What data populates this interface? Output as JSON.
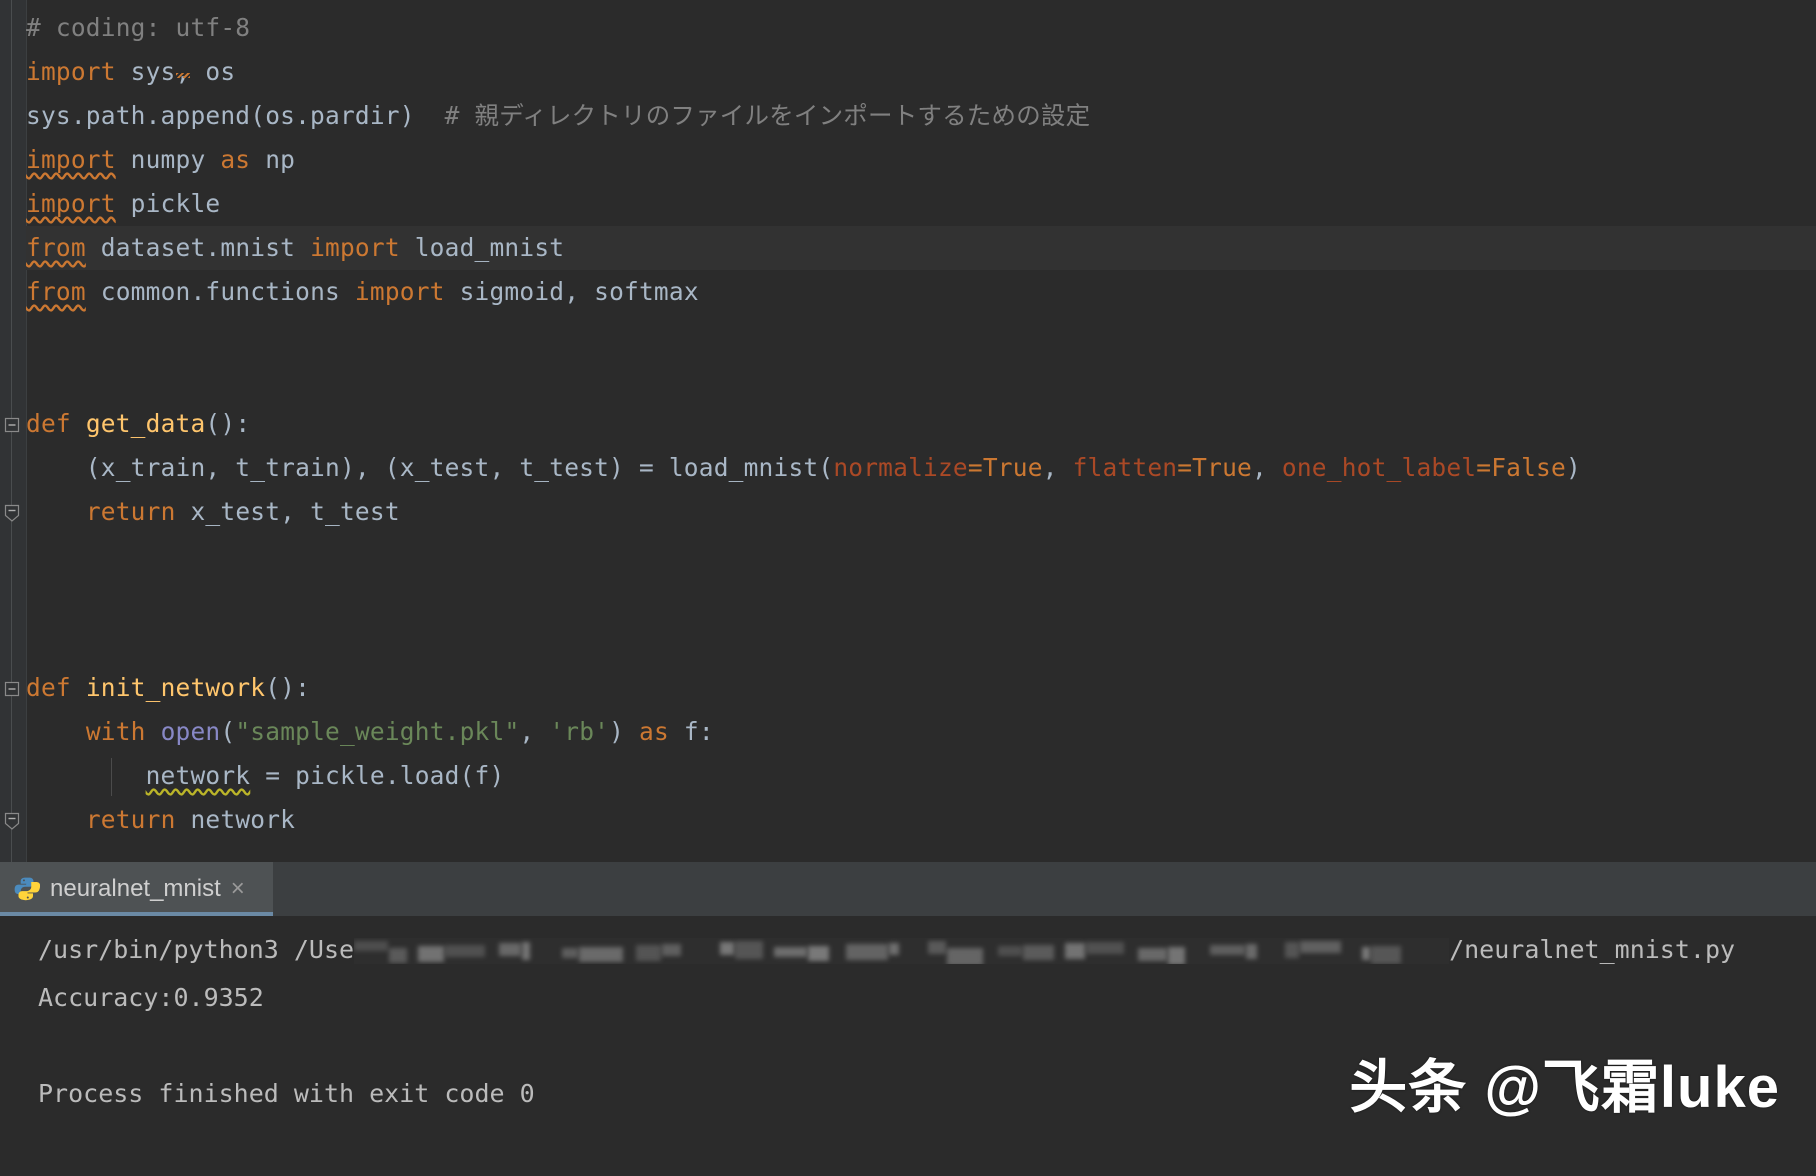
{
  "editor": {
    "lines": [
      {
        "id": "l1",
        "tokens": [
          {
            "t": "# coding: utf-8",
            "c": "cmt"
          }
        ]
      },
      {
        "id": "l2",
        "tokens": [
          {
            "t": "import",
            "c": "kw"
          },
          {
            "t": " sys",
            "c": "plain"
          },
          {
            "t": ",",
            "c": "typo"
          },
          {
            "t": " os",
            "c": "plain"
          }
        ]
      },
      {
        "id": "l3",
        "tokens": [
          {
            "t": "sys.path.append(os.pardir)",
            "c": "plain"
          },
          {
            "t": "  # 親ディレクトリのファイルをインポートするための設定",
            "c": "cmt"
          }
        ]
      },
      {
        "id": "l4",
        "tokens": [
          {
            "t": "import",
            "c": "kw-sq"
          },
          {
            "t": " numpy ",
            "c": "plain"
          },
          {
            "t": "as",
            "c": "kw"
          },
          {
            "t": " np",
            "c": "plain"
          }
        ]
      },
      {
        "id": "l5",
        "tokens": [
          {
            "t": "import",
            "c": "kw-sq"
          },
          {
            "t": " pickle",
            "c": "plain"
          }
        ]
      },
      {
        "id": "l6",
        "hl": true,
        "tokens": [
          {
            "t": "from",
            "c": "kw-sq"
          },
          {
            "t": " dataset.mnist ",
            "c": "plain"
          },
          {
            "t": "import",
            "c": "kw"
          },
          {
            "t": " load_mnist",
            "c": "plain"
          }
        ]
      },
      {
        "id": "l7",
        "tokens": [
          {
            "t": "from",
            "c": "kw-sq"
          },
          {
            "t": " common.functions ",
            "c": "plain"
          },
          {
            "t": "import",
            "c": "kw"
          },
          {
            "t": " sigmoid, softmax",
            "c": "plain"
          }
        ]
      },
      {
        "id": "l8",
        "tokens": []
      },
      {
        "id": "l9",
        "tokens": []
      },
      {
        "id": "l10",
        "fold": "start",
        "tokens": [
          {
            "t": "def",
            "c": "kw"
          },
          {
            "t": " ",
            "c": "plain"
          },
          {
            "t": "get_data",
            "c": "fn"
          },
          {
            "t": "():",
            "c": "plain"
          }
        ]
      },
      {
        "id": "l11",
        "tokens": [
          {
            "t": "    (x_train, t_train), (x_test, t_test) = load_mnist(",
            "c": "plain"
          },
          {
            "t": "normalize",
            "c": "kwarg"
          },
          {
            "t": "=",
            "c": "kw"
          },
          {
            "t": "True",
            "c": "const"
          },
          {
            "t": ", ",
            "c": "plain"
          },
          {
            "t": "flatten",
            "c": "kwarg"
          },
          {
            "t": "=",
            "c": "kw"
          },
          {
            "t": "True",
            "c": "const"
          },
          {
            "t": ", ",
            "c": "plain"
          },
          {
            "t": "one_hot_label",
            "c": "kwarg"
          },
          {
            "t": "=",
            "c": "kw"
          },
          {
            "t": "False",
            "c": "const"
          },
          {
            "t": ")",
            "c": "plain"
          }
        ]
      },
      {
        "id": "l12",
        "fold": "end",
        "tokens": [
          {
            "t": "    ",
            "c": "plain"
          },
          {
            "t": "return",
            "c": "kw"
          },
          {
            "t": " x_test, t_test",
            "c": "plain"
          }
        ]
      },
      {
        "id": "l13",
        "tokens": []
      },
      {
        "id": "l14",
        "tokens": []
      },
      {
        "id": "l15",
        "tokens": []
      },
      {
        "id": "l16",
        "fold": "start",
        "tokens": [
          {
            "t": "def",
            "c": "kw"
          },
          {
            "t": " ",
            "c": "plain"
          },
          {
            "t": "init_network",
            "c": "fn"
          },
          {
            "t": "():",
            "c": "plain"
          }
        ]
      },
      {
        "id": "l17",
        "tokens": [
          {
            "t": "    ",
            "c": "plain"
          },
          {
            "t": "with",
            "c": "kw"
          },
          {
            "t": " ",
            "c": "plain"
          },
          {
            "t": "open",
            "c": "bi"
          },
          {
            "t": "(",
            "c": "plain"
          },
          {
            "t": "\"sample_weight.pkl\"",
            "c": "str"
          },
          {
            "t": ", ",
            "c": "plain"
          },
          {
            "t": "'rb'",
            "c": "str"
          },
          {
            "t": ") ",
            "c": "plain"
          },
          {
            "t": "as",
            "c": "kw"
          },
          {
            "t": " f:",
            "c": "plain"
          }
        ]
      },
      {
        "id": "l18",
        "tokens": [
          {
            "t": "        ",
            "c": "plain"
          },
          {
            "t": "network",
            "c": "plain-sqy"
          },
          {
            "t": " = pickle.load(f)",
            "c": "plain"
          }
        ]
      },
      {
        "id": "l19",
        "fold": "end",
        "tokens": [
          {
            "t": "    ",
            "c": "plain"
          },
          {
            "t": "return",
            "c": "kw"
          },
          {
            "t": " network",
            "c": "plain"
          }
        ]
      },
      {
        "id": "l20",
        "tokens": []
      },
      {
        "id": "l21",
        "tokens": []
      }
    ]
  },
  "console": {
    "tab": {
      "label": "neuralnet_mnist",
      "close_label": "×",
      "icon": "python-icon"
    },
    "lines": [
      {
        "id": "c1",
        "prefix": "/usr/bin/python3 /Use",
        "blurred": true,
        "suffix": "/neuralnet_mnist.py"
      },
      {
        "id": "c2",
        "prefix": "Accuracy:0.9352",
        "blurred": false,
        "suffix": ""
      },
      {
        "id": "c3",
        "prefix": "",
        "blurred": false,
        "suffix": ""
      },
      {
        "id": "c4",
        "prefix": "Process finished with exit code 0",
        "blurred": false,
        "suffix": ""
      }
    ]
  },
  "watermark": {
    "text": "头条 @飞霜luke"
  },
  "colors": {
    "editor_bg": "#2b2b2b",
    "gutter_bg": "#313335",
    "tabbar_bg": "#3c3f41",
    "tab_active_bg": "#4e5254",
    "tab_underline": "#6b8aa5",
    "keyword": "#cc7832",
    "function": "#ffc66d",
    "builtin": "#8888c6",
    "string": "#6a8759",
    "comment": "#808080",
    "text": "#a9b7c6",
    "kwarg": "#aa4926",
    "console_text": "#bbbbbb",
    "line_highlight": "#323232"
  }
}
